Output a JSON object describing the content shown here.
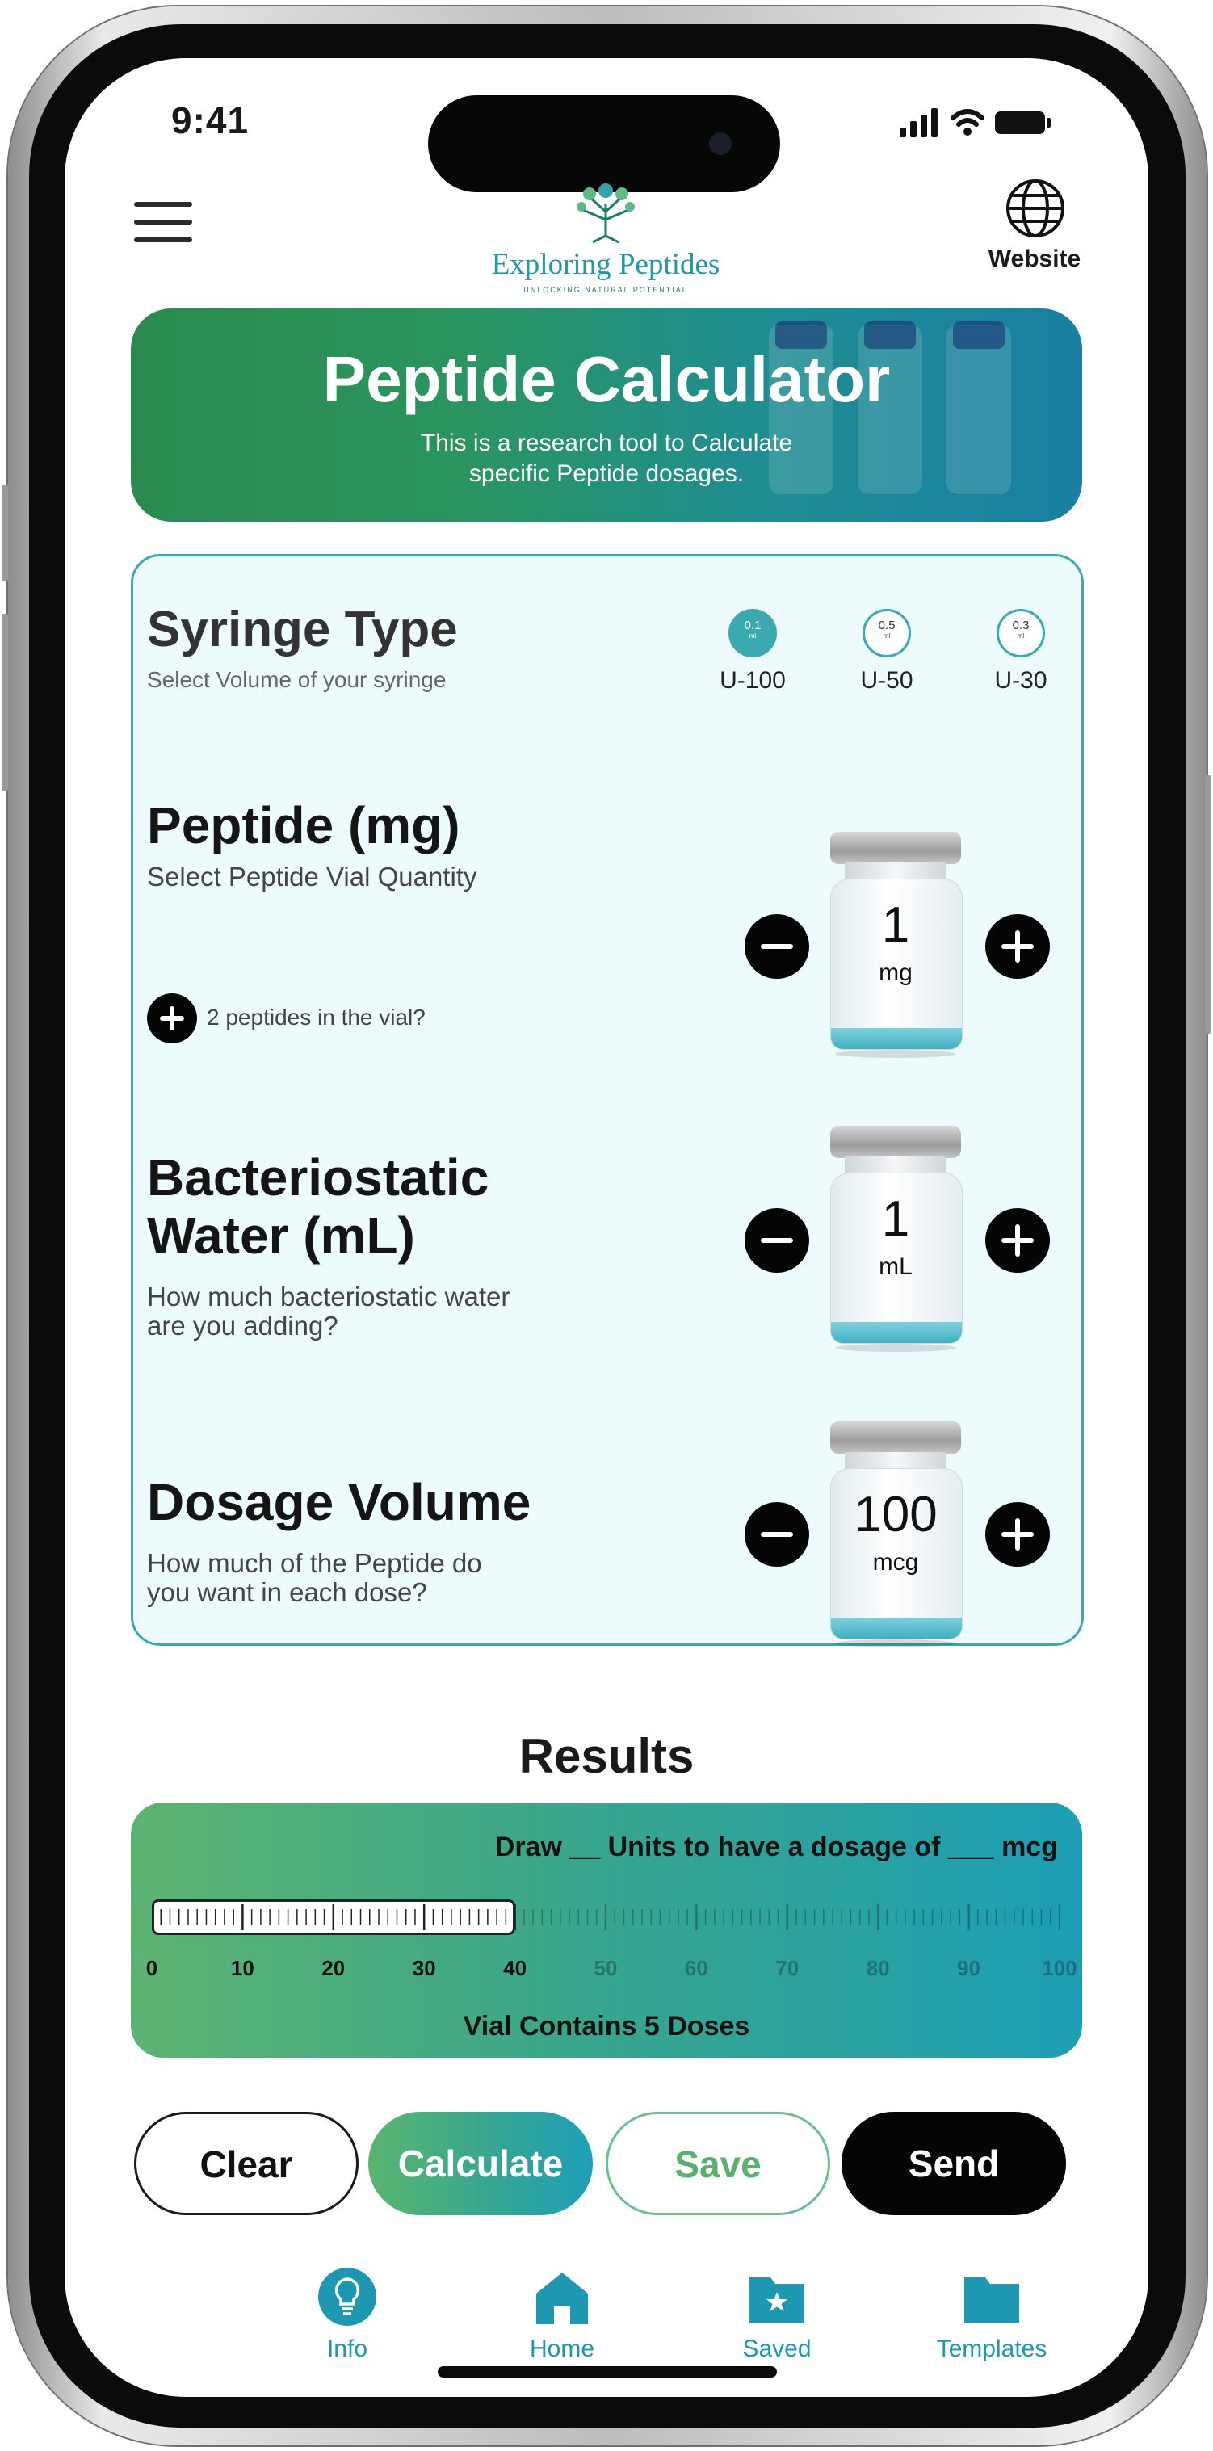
{
  "status_bar": {
    "time": "9:41"
  },
  "header": {
    "logo_title": "Exploring Peptides",
    "logo_tagline": "UNLOCKING NATURAL POTENTIAL",
    "website_label": "Website"
  },
  "banner": {
    "title": "Peptide Calculator",
    "subtitle_line1": "This is a research tool to Calculate",
    "subtitle_line2": "specific Peptide dosages."
  },
  "syringe": {
    "title": "Syringe Type",
    "subtitle": "Select Volume of your syringe",
    "options": [
      {
        "volume": "0.1",
        "unit": "ml",
        "label": "U-100",
        "selected": true
      },
      {
        "volume": "0.5",
        "unit": "ml",
        "label": "U-50",
        "selected": false
      },
      {
        "volume": "0.3",
        "unit": "ml",
        "label": "U-30",
        "selected": false
      }
    ]
  },
  "peptide": {
    "title": "Peptide (mg)",
    "subtitle": "Select Peptide Vial Quantity",
    "value": "1",
    "unit": "mg",
    "add_second_label": "2 peptides in the vial?"
  },
  "water": {
    "title_line1": "Bacteriostatic",
    "title_line2": "Water (mL)",
    "subtitle_line1": "How much bacteriostatic water",
    "subtitle_line2": "are you adding?",
    "value": "1",
    "unit": "mL"
  },
  "dosage": {
    "title": "Dosage Volume",
    "subtitle_line1": "How much of the Peptide do",
    "subtitle_line2": "you want in each dose?",
    "value": "100",
    "unit": "mcg"
  },
  "results": {
    "heading": "Results",
    "draw_text": "Draw __ Units to have a dosage of ___ mcg",
    "scale_labels": [
      "0",
      "10",
      "20",
      "30",
      "40",
      "50",
      "60",
      "70",
      "80",
      "90",
      "100"
    ],
    "plunger_units": 40,
    "doses_text": "Vial Contains 5 Doses"
  },
  "actions": {
    "clear": "Clear",
    "calculate": "Calculate",
    "save": "Save",
    "send": "Send"
  },
  "tabs": [
    {
      "label": "Info",
      "icon": "lightbulb-icon"
    },
    {
      "label": "Home",
      "icon": "home-icon"
    },
    {
      "label": "Saved",
      "icon": "star-folder-icon"
    },
    {
      "label": "Templates",
      "icon": "folder-icon"
    }
  ],
  "colors": {
    "accent": "#3aaab0",
    "tab": "#1d98b0",
    "green": "#2a9560",
    "card_bg": "#edfbfd"
  }
}
